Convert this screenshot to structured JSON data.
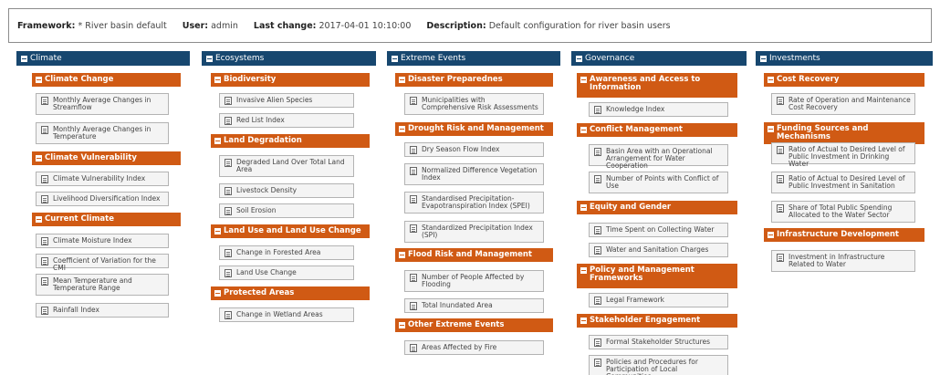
{
  "header": {
    "framework_label": "Framework:",
    "framework_value": "* River basin default",
    "user_label": "User:",
    "user_value": "admin",
    "last_change_label": "Last change:",
    "last_change_value": "2017-04-01 10:10:00",
    "description_label": "Description:",
    "description_value": "Default configuration for river basin users"
  },
  "colors": {
    "column_header": "#17476f",
    "category_header": "#d05a14",
    "indicator_bg": "#f4f4f4"
  },
  "icons": {
    "collapse": "minus-box-icon",
    "indicator": "document-icon"
  },
  "columns": [
    {
      "title": "Climate",
      "categories": [
        {
          "title": "Climate Change",
          "indicators": [
            "Monthly Average Changes in Streamflow",
            "Monthly Average Changes in Temperature"
          ]
        },
        {
          "title": "Climate Vulnerability",
          "indicators": [
            "Climate Vulnerability Index",
            "Livelihood Diversification Index"
          ]
        },
        {
          "title": "Current Climate",
          "indicators": [
            "Climate Moisture Index",
            "Coefficient of Variation for the CMI",
            "Mean Temperature and Temperature Range",
            "Rainfall Index"
          ]
        }
      ]
    },
    {
      "title": "Ecosystems",
      "categories": [
        {
          "title": "Biodiversity",
          "indicators": [
            "Invasive Alien Species",
            "Red List Index"
          ]
        },
        {
          "title": "Land Degradation",
          "indicators": [
            "Degraded Land Over Total Land Area",
            "Livestock Density",
            "Soil Erosion"
          ]
        },
        {
          "title": "Land Use and Land Use Change",
          "indicators": [
            "Change in Forested Area",
            "Land Use Change"
          ]
        },
        {
          "title": "Protected Areas",
          "indicators": [
            "Change in Wetland Areas"
          ]
        }
      ]
    },
    {
      "title": "Extreme Events",
      "categories": [
        {
          "title": "Disaster Preparednes",
          "indicators": [
            "Municipalities with Comprehensive Risk Assessments"
          ]
        },
        {
          "title": "Drought Risk and Management",
          "indicators": [
            "Dry Season Flow Index",
            "Normalized Difference Vegetation Index",
            "Standardised Precipitation-Evapotranspiration Index (SPEI)",
            "Standardized Precipitation Index (SPI)"
          ]
        },
        {
          "title": "Flood Risk and Management",
          "indicators": [
            "Number of People Affected by Flooding",
            "Total Inundated Area"
          ]
        },
        {
          "title": "Other Extreme Events",
          "indicators": [
            "Areas Affected by Fire"
          ]
        }
      ]
    },
    {
      "title": "Governance",
      "categories": [
        {
          "title": "Awareness and Access to Information",
          "indicators": [
            "Knowledge Index"
          ]
        },
        {
          "title": "Conflict Management",
          "indicators": [
            "Basin Area with an Operational Arrangement for Water Cooperation",
            "Number of Points with Conflict of Use"
          ]
        },
        {
          "title": "Equity and Gender",
          "indicators": [
            "Time Spent on Collecting Water",
            "Water and Sanitation Charges"
          ]
        },
        {
          "title": "Policy and Management Frameworks",
          "indicators": [
            "Legal Framework"
          ]
        },
        {
          "title": "Stakeholder Engagement",
          "indicators": [
            "Formal Stakeholder Structures",
            "Policies and Procedures for Participation of Local Communities"
          ]
        }
      ]
    },
    {
      "title": "Investments",
      "categories": [
        {
          "title": "Cost Recovery",
          "indicators": [
            "Rate of Operation and Maintenance Cost Recovery"
          ]
        },
        {
          "title": "Funding Sources and Mechanisms",
          "indicators": [
            "Ratio of Actual to Desired Level of Public Investment in Drinking Water",
            "Ratio of Actual to Desired Level of Public Investment in Sanitation",
            "Share of Total Public Spending Allocated to the Water Sector"
          ]
        },
        {
          "title": "Infrastructure Development",
          "indicators": [
            "Investment in Infrastructure Related to Water"
          ]
        }
      ]
    }
  ]
}
